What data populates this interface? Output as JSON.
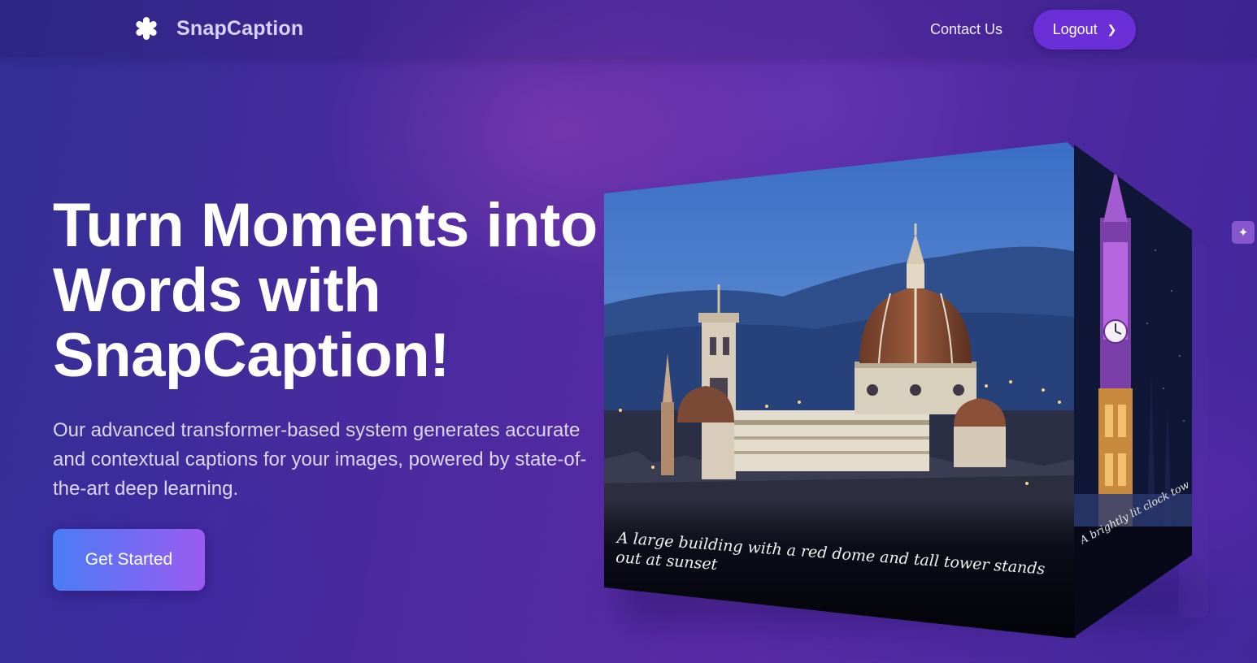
{
  "header": {
    "brand_name": "SnapCaption",
    "brand_icon": "snowflake-asterisk-icon",
    "contact_label": "Contact Us",
    "logout_label": "Logout",
    "logout_icon": "chevron-right-icon"
  },
  "hero": {
    "title_line1": "Turn Moments into",
    "title_line2": "Words with",
    "title_line3": "SnapCaption!",
    "description": "Our advanced transformer-based system generates accurate and contextual captions for your images, powered by state-of-the-art deep learning.",
    "cta_label": "Get Started"
  },
  "showcase": {
    "front_caption": "A large building with a red dome and tall tower stands out at sunset",
    "side_caption": "A brightly lit clock tower glows purple against the night sky"
  },
  "colors": {
    "accent": "#6a2fd6",
    "cta_start": "#4a7cf6",
    "cta_end": "#9b5bf0",
    "brand_text": "#d9d2ff"
  },
  "side_widget": {
    "icon": "sparkle-chat-icon"
  }
}
